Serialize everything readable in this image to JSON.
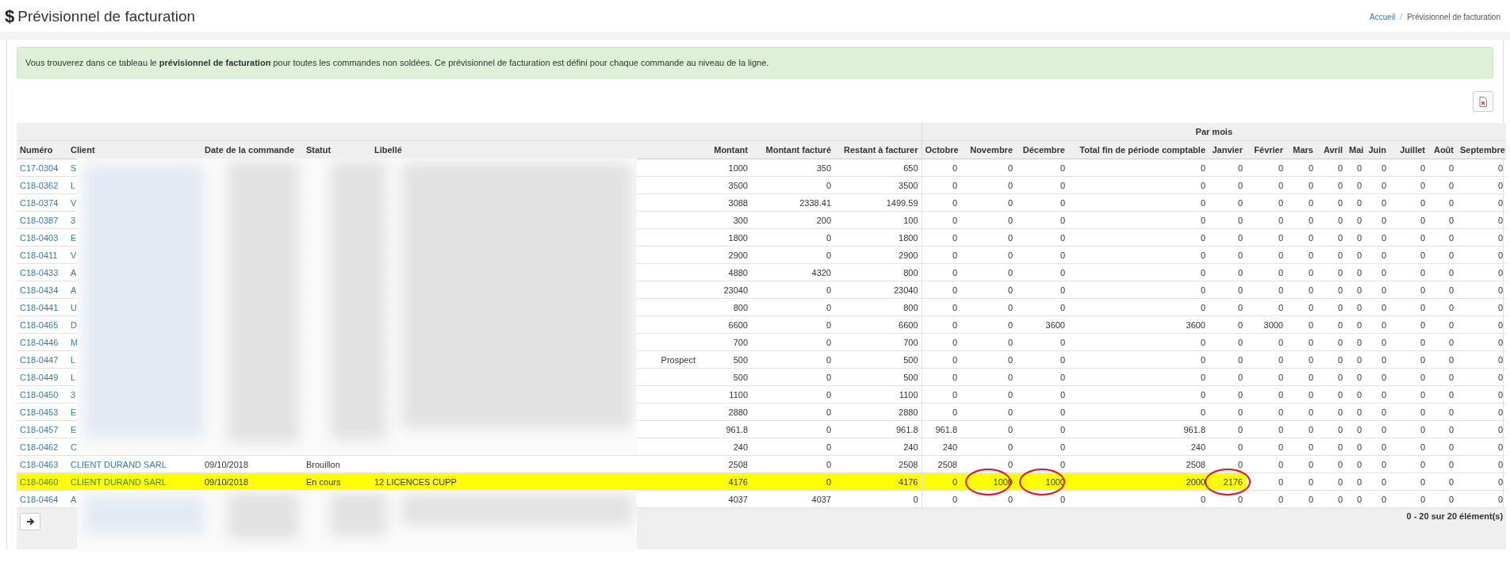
{
  "header": {
    "icon": "$",
    "title": "Prévisionnel de facturation",
    "breadcrumb": {
      "separator": "/",
      "items": [
        {
          "label": "Accueil",
          "kind": "link"
        },
        {
          "label": "Prévisionnel de facturation",
          "kind": "current"
        }
      ]
    }
  },
  "alert": {
    "text": "Vous trouverez dans ce tableau le **prévisionnel de facturation** pour toutes les commandes non soldées. Ce prévisionnel de facturation est défini pour chaque commande au niveau de la ligne."
  },
  "table": {
    "group_header": "Par mois",
    "columns": [
      "Numéro",
      "Client",
      "Date de la commande",
      "Statut",
      "Libellé",
      "Montant",
      "Montant facturé",
      "Restant à facturer",
      "Octobre",
      "Novembre",
      "Décembre",
      "Total fin de période comptable",
      "Janvier",
      "Février",
      "Mars",
      "Avril",
      "Mai",
      "Juin",
      "Juillet",
      "Août",
      "Septembre"
    ],
    "rows": [
      {
        "numero": "C17-0304",
        "client": "S",
        "redacted": true,
        "highlighted": false,
        "values": [
          "1000",
          "350",
          "650",
          "0",
          "0",
          "0",
          "0",
          "0",
          "0",
          "0",
          "0",
          "0",
          "0",
          "0",
          "0",
          "0"
        ]
      },
      {
        "numero": "C18-0362",
        "client": "L",
        "redacted": true,
        "highlighted": false,
        "values": [
          "3500",
          "0",
          "3500",
          "0",
          "0",
          "0",
          "0",
          "0",
          "0",
          "0",
          "0",
          "0",
          "0",
          "0",
          "0",
          "0"
        ]
      },
      {
        "numero": "C18-0374",
        "client": "V",
        "redacted": true,
        "highlighted": false,
        "values": [
          "3088",
          "2338.41",
          "1499.59",
          "0",
          "0",
          "0",
          "0",
          "0",
          "0",
          "0",
          "0",
          "0",
          "0",
          "0",
          "0",
          "0"
        ]
      },
      {
        "numero": "C18-0387",
        "client": "3",
        "redacted": true,
        "highlighted": false,
        "values": [
          "300",
          "200",
          "100",
          "0",
          "0",
          "0",
          "0",
          "0",
          "0",
          "0",
          "0",
          "0",
          "0",
          "0",
          "0",
          "0"
        ]
      },
      {
        "numero": "C18-0403",
        "client": "E",
        "redacted": true,
        "highlighted": false,
        "values": [
          "1800",
          "0",
          "1800",
          "0",
          "0",
          "0",
          "0",
          "0",
          "0",
          "0",
          "0",
          "0",
          "0",
          "0",
          "0",
          "0"
        ]
      },
      {
        "numero": "C18-0411",
        "client": "V",
        "redacted": true,
        "highlighted": false,
        "values": [
          "2900",
          "0",
          "2900",
          "0",
          "0",
          "0",
          "0",
          "0",
          "0",
          "0",
          "0",
          "0",
          "0",
          "0",
          "0",
          "0"
        ]
      },
      {
        "numero": "C18-0433",
        "client": "A",
        "redacted": true,
        "highlighted": false,
        "values": [
          "4880",
          "4320",
          "800",
          "0",
          "0",
          "0",
          "0",
          "0",
          "0",
          "0",
          "0",
          "0",
          "0",
          "0",
          "0",
          "0"
        ]
      },
      {
        "numero": "C18-0434",
        "client": "A",
        "redacted": true,
        "highlighted": false,
        "values": [
          "23040",
          "0",
          "23040",
          "0",
          "0",
          "0",
          "0",
          "0",
          "0",
          "0",
          "0",
          "0",
          "0",
          "0",
          "0",
          "0"
        ]
      },
      {
        "numero": "C18-0441",
        "client": "U",
        "redacted": true,
        "highlighted": false,
        "values": [
          "800",
          "0",
          "800",
          "0",
          "0",
          "0",
          "0",
          "0",
          "0",
          "0",
          "0",
          "0",
          "0",
          "0",
          "0",
          "0"
        ]
      },
      {
        "numero": "C18-0465",
        "client": "D",
        "redacted": true,
        "highlighted": false,
        "values": [
          "6600",
          "0",
          "6600",
          "0",
          "0",
          "3600",
          "3600",
          "0",
          "3000",
          "0",
          "0",
          "0",
          "0",
          "0",
          "0",
          "0"
        ]
      },
      {
        "numero": "C18-0446",
        "client": "M",
        "redacted": true,
        "highlighted": false,
        "values": [
          "700",
          "0",
          "700",
          "0",
          "0",
          "0",
          "0",
          "0",
          "0",
          "0",
          "0",
          "0",
          "0",
          "0",
          "0",
          "0"
        ]
      },
      {
        "numero": "C18-0447",
        "client": "L",
        "libelle": "Prospect",
        "redacted": true,
        "highlighted": false,
        "values": [
          "500",
          "0",
          "500",
          "0",
          "0",
          "0",
          "0",
          "0",
          "0",
          "0",
          "0",
          "0",
          "0",
          "0",
          "0",
          "0"
        ]
      },
      {
        "numero": "C18-0449",
        "client": "L",
        "redacted": true,
        "highlighted": false,
        "values": [
          "500",
          "0",
          "500",
          "0",
          "0",
          "0",
          "0",
          "0",
          "0",
          "0",
          "0",
          "0",
          "0",
          "0",
          "0",
          "0"
        ]
      },
      {
        "numero": "C18-0450",
        "client": "3",
        "redacted": true,
        "highlighted": false,
        "values": [
          "1100",
          "0",
          "1100",
          "0",
          "0",
          "0",
          "0",
          "0",
          "0",
          "0",
          "0",
          "0",
          "0",
          "0",
          "0",
          "0"
        ]
      },
      {
        "numero": "C18-0453",
        "client": "E",
        "redacted": true,
        "highlighted": false,
        "values": [
          "2880",
          "0",
          "2880",
          "0",
          "0",
          "0",
          "0",
          "0",
          "0",
          "0",
          "0",
          "0",
          "0",
          "0",
          "0",
          "0"
        ]
      },
      {
        "numero": "C18-0457",
        "client": "E",
        "redacted": true,
        "highlighted": false,
        "values": [
          "961.8",
          "0",
          "961.8",
          "961.8",
          "0",
          "0",
          "961.8",
          "0",
          "0",
          "0",
          "0",
          "0",
          "0",
          "0",
          "0",
          "0"
        ]
      },
      {
        "numero": "C18-0462",
        "client": "C",
        "redacted": true,
        "highlighted": false,
        "values": [
          "240",
          "0",
          "240",
          "240",
          "0",
          "0",
          "240",
          "0",
          "0",
          "0",
          "0",
          "0",
          "0",
          "0",
          "0",
          "0"
        ]
      },
      {
        "numero": "C18-0463",
        "client": "CLIENT DURAND SARL",
        "date": "09/10/2018",
        "statut": "Brouillon",
        "redacted": false,
        "highlighted": false,
        "values": [
          "2508",
          "0",
          "2508",
          "2508",
          "0",
          "0",
          "2508",
          "0",
          "0",
          "0",
          "0",
          "0",
          "0",
          "0",
          "0",
          "0"
        ]
      },
      {
        "numero": "C18-0460",
        "client": "CLIENT DURAND SARL",
        "date": "09/10/2018",
        "statut": "En cours",
        "libelle": "12 LICENCES CUPP",
        "redacted": false,
        "highlighted": true,
        "values": [
          "4176",
          "0",
          "4176",
          "0",
          {
            "text": "1000",
            "circled": true
          },
          {
            "text": "1000",
            "circled": true
          },
          "2000",
          {
            "text": "2176",
            "circled": true
          },
          "0",
          "0",
          "0",
          "0",
          "0",
          "0",
          "0",
          "0"
        ]
      },
      {
        "numero": "C18-0464",
        "client": "A",
        "redacted": true,
        "highlighted": false,
        "values": [
          "4037",
          "4037",
          "0",
          "0",
          "0",
          "0",
          "0",
          "0",
          "0",
          "0",
          "0",
          "0",
          "0",
          "0",
          "0",
          "0"
        ]
      }
    ],
    "footer": {
      "summary": "0 - 20 sur 20 élément(s)"
    }
  }
}
